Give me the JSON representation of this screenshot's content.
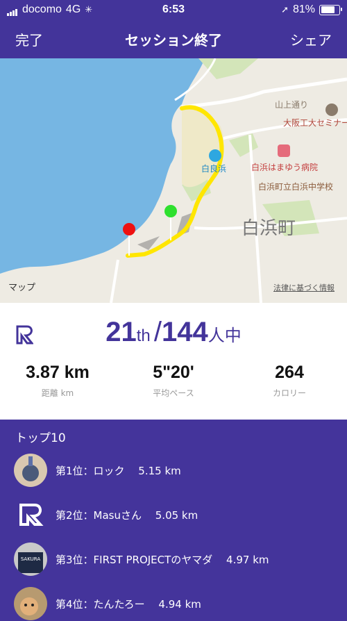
{
  "status_bar": {
    "carrier": "docomo",
    "network": "4G",
    "time": "6:53",
    "battery": "81%",
    "battery_level": 0.81
  },
  "nav": {
    "done": "完了",
    "title": "セッション終了",
    "share": "シェア"
  },
  "map": {
    "labels": {
      "yamanoue": "山上通り",
      "osaka": "大阪工大セミナー",
      "shirarahama": "白良浜",
      "hospital": "白浜はまゆう病院",
      "school": "白浜町立白浜中学校",
      "town": "白浜町"
    },
    "apple_maps": "マップ",
    "legal": "法律に基づく情報"
  },
  "result": {
    "rank": "21",
    "rank_suffix": "th",
    "slash": "/",
    "total": "144",
    "total_suffix": "人中",
    "stats": [
      {
        "value": "3.87 km",
        "label": "距離 km"
      },
      {
        "value": "5\"20'",
        "label": "平均ペース"
      },
      {
        "value": "264",
        "label": "カロリー"
      }
    ]
  },
  "top10": {
    "header": "トップ10",
    "rows": [
      {
        "text": "第1位：ロック　 5.15 km",
        "avatar": "medal-photo"
      },
      {
        "text": "第2位：Masuさん　 5.05 km",
        "avatar": "r-logo"
      },
      {
        "text": "第3位：FIRST PROJECTのヤマダ　 4.97 km",
        "avatar": "shirt-photo"
      },
      {
        "text": "第4位：たんたろー　 4.94 km",
        "avatar": "cat-photo"
      }
    ]
  },
  "colors": {
    "brand": "#43349a",
    "route": "#ffe600",
    "start_pin": "#2ee02e",
    "end_pin": "#ee1111"
  }
}
